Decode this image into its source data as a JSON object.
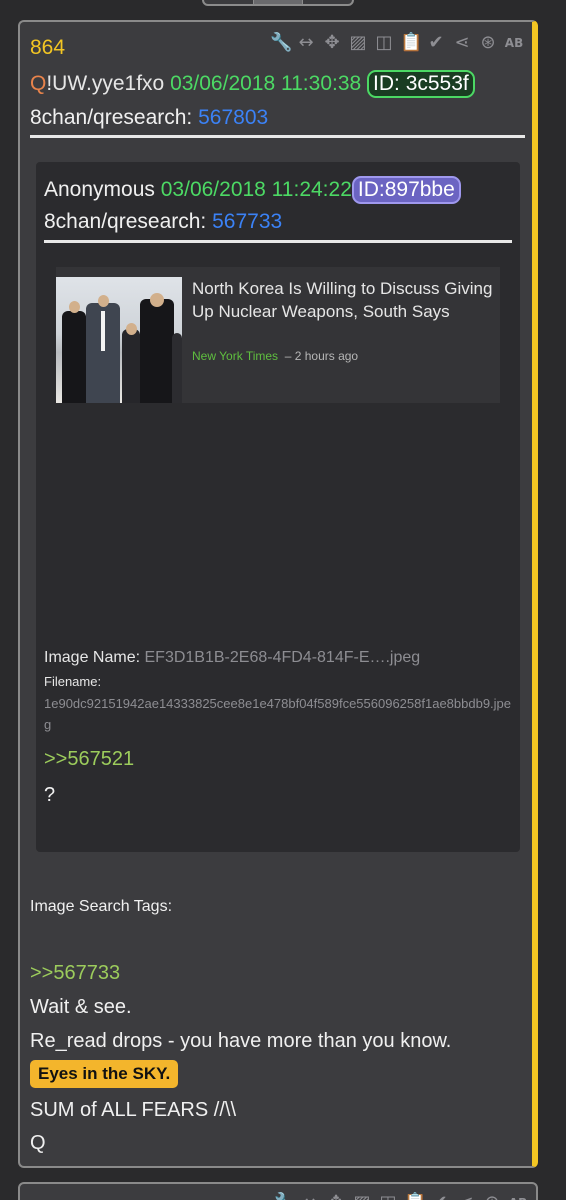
{
  "post": {
    "number": "864",
    "trip_prefix": "Q",
    "trip": "!UW.yye1fxo",
    "date": "03/06/2018 11:30:38",
    "id": "ID: 3c553f",
    "board": "8chan/qresearch:",
    "post_link": "567803"
  },
  "toolbar": {
    "icons": [
      "wrench-icon",
      "resize-arrows-icon",
      "move-icon",
      "image-file-icon",
      "vr-headset-icon",
      "clipboard-icon",
      "clipboard-check-icon",
      "share-icon",
      "caret-circle-icon",
      "text-ab-icon"
    ],
    "glyphs": [
      "🔧",
      "↔",
      "✥",
      "▨",
      "◫",
      "📋",
      "✔",
      "⋖",
      "⊛",
      "AB"
    ]
  },
  "quoted": {
    "author": "Anonymous",
    "date": "03/06/2018 11:24:22",
    "id": "ID:897bbe",
    "board": "8chan/qresearch:",
    "post_link": "567733",
    "article": {
      "title": "North Korea Is Willing to Discuss Giving Up Nuclear Weapons, South Says",
      "source": "New York Times",
      "time": "– 2 hours ago"
    },
    "image_name_label": "Image Name:",
    "image_name_value": "EF3D1B1B-2E68-4FD4-814F-E….jpeg",
    "filename_label": "Filename:",
    "filename_value": "1e90dc92151942ae14333825cee8e1e478bf04f589fce556096258f1ae8bbdb9.jpeg",
    "reply_link": ">>567521",
    "text": "?"
  },
  "tags_label": "Image Search Tags:",
  "body": {
    "reply_link": ">>567733",
    "line1": "Wait & see.",
    "line2": "Re_read drops - you have more than you know.",
    "highlight": "Eyes in the SKY.",
    "line3": "SUM of ALL FEARS //\\\\",
    "line4": "Q"
  },
  "colors": {
    "accent_yellow": "#f3c623",
    "date_green": "#4cd964",
    "link_blue": "#3b82f6",
    "greentext": "#9ccc5c",
    "background": "#2a2a2c"
  }
}
